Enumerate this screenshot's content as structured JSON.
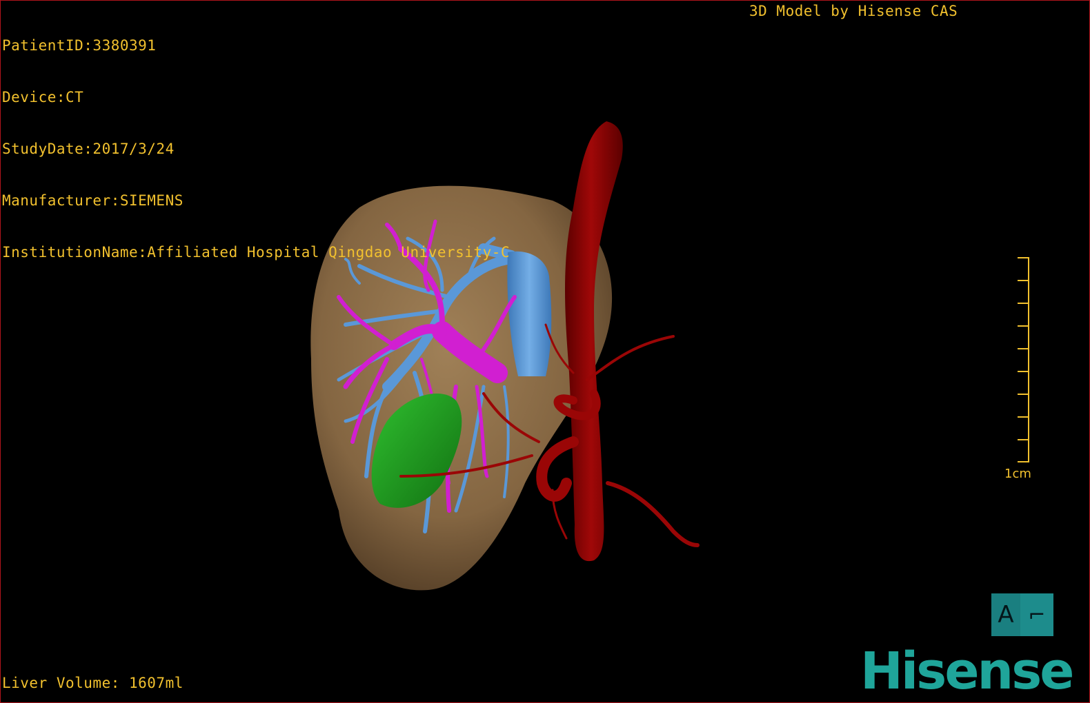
{
  "header": {
    "patient_id": "PatientID:3380391",
    "device": "Device:CT",
    "study_date": "StudyDate:2017/3/24",
    "manufacturer": "Manufacturer:SIEMENS",
    "institution": "InstitutionName:Affiliated Hospital Qingdao University-C",
    "brand_title": "3D Model by Hisense CAS"
  },
  "footer": {
    "liver_volume": "Liver Volume: 1607ml"
  },
  "scale": {
    "label": "1cm",
    "ticks": 10
  },
  "orientation": {
    "primary": "A",
    "secondary": "⌐"
  },
  "logo": {
    "text": "Hisense"
  },
  "colors": {
    "overlay_text": "#f2c12e",
    "liver": "#8b6b45",
    "portal_vein": "#d11fd1",
    "hepatic_vein": "#5a98d8",
    "aorta": "#8b0000",
    "gallbladder": "#1e9a1e",
    "logo": "#1fa59a"
  }
}
